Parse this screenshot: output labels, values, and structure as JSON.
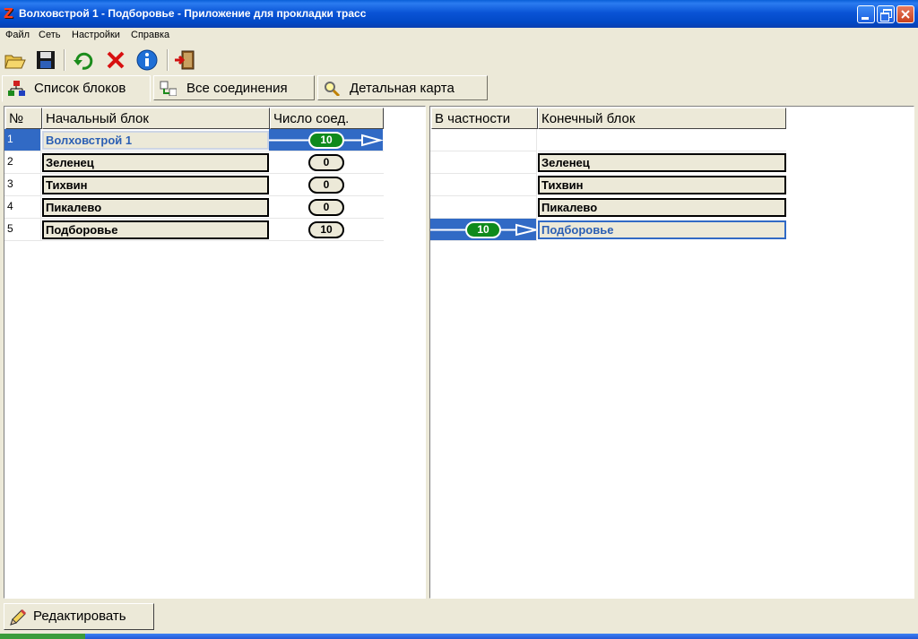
{
  "window": {
    "title": "Волховстрой 1 - Подборовье - Приложение для прокладки трасс",
    "app_icon": "Z"
  },
  "menu": [
    "Файл",
    "Сеть",
    "Настройки",
    "Справка"
  ],
  "toolbar": {
    "icons": [
      "open-folder-icon",
      "save-disk-icon",
      "refresh-icon",
      "delete-x-icon",
      "info-icon",
      "exit-door-icon"
    ]
  },
  "tabs": [
    {
      "label": "Список блоков",
      "icon": "blocks-icon",
      "active": true
    },
    {
      "label": "Все соединения",
      "icon": "connections-icon",
      "active": false
    },
    {
      "label": "Детальная карта",
      "icon": "magnifier-icon",
      "active": false
    }
  ],
  "left_grid": {
    "headers": [
      "№",
      "Начальный блок",
      "Число соед."
    ],
    "rows": [
      {
        "num": "1",
        "block": "Волховстрой 1",
        "count": "10",
        "selected": true
      },
      {
        "num": "2",
        "block": "Зеленец",
        "count": "0",
        "selected": false
      },
      {
        "num": "3",
        "block": "Тихвин",
        "count": "0",
        "selected": false
      },
      {
        "num": "4",
        "block": "Пикалево",
        "count": "0",
        "selected": false
      },
      {
        "num": "5",
        "block": "Подборовье",
        "count": "10",
        "selected": false
      }
    ]
  },
  "right_grid": {
    "headers": [
      "В частности",
      "Конечный блок"
    ],
    "rows": [
      {
        "count": "",
        "block": "",
        "selected": false
      },
      {
        "count": "",
        "block": "Зеленец",
        "selected": false
      },
      {
        "count": "",
        "block": "Тихвин",
        "selected": false
      },
      {
        "count": "",
        "block": "Пикалево",
        "selected": false
      },
      {
        "count": "10",
        "block": "Подборовье",
        "selected": true
      }
    ]
  },
  "footer": {
    "edit_label": "Редактировать"
  },
  "colors": {
    "selection": "#316ac5",
    "badge_green": "#0f8a1c",
    "face": "#ece9d8"
  }
}
